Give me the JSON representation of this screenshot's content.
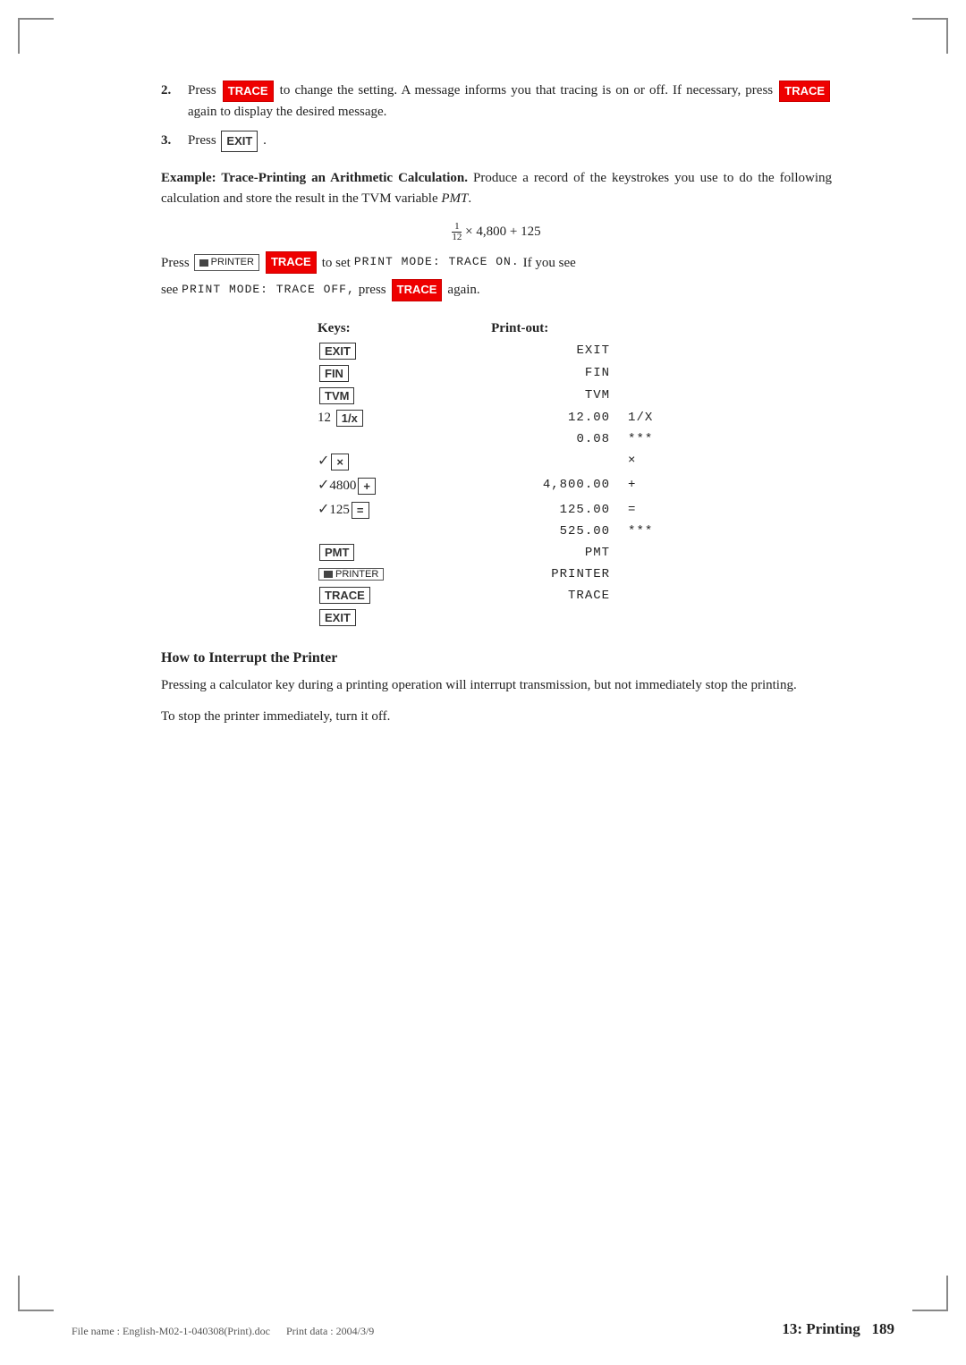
{
  "corner_marks": [
    "tl",
    "tr",
    "bl",
    "br"
  ],
  "step2": {
    "num": "2.",
    "text_before_key1": "Press",
    "key1": "TRACE",
    "text_after_key1": "to change the setting. A message informs you that tracing is on or off. If necessary, press",
    "key2": "TRACE",
    "text_after_key2": "again to display the desired message."
  },
  "step3": {
    "num": "3.",
    "text_before_key": "Press",
    "key": "EXIT",
    "text_after_key": "."
  },
  "example": {
    "label": "Example: Trace-Printing an Arithmetic Calculation.",
    "description": "Produce a record of the keystrokes you use to do the following calculation and store the result in the TVM variable",
    "variable": "PMT",
    "formula_numerator": "1",
    "formula_denominator": "12",
    "formula_rest": "× 4,800 + 125",
    "print_mode_intro": "Press",
    "print_mode_key1_icon": "printer",
    "print_mode_key2": "TRACE",
    "print_mode_text": "to set",
    "print_mode_code": "PRINT MODE: TRACE ON.",
    "print_mode_suffix": "If you see",
    "print_mode_code2": "PRINT MODE: TRACE OFF,",
    "print_mode_key3": "TRACE",
    "print_mode_end": "again."
  },
  "table": {
    "col1_header": "Keys:",
    "col2_header": "Print-out:",
    "rows": [
      {
        "key_type": "badge",
        "key_label": "EXIT",
        "key_badge_style": "plain",
        "printout": "EXIT",
        "symbol": ""
      },
      {
        "key_type": "badge",
        "key_label": "FIN",
        "key_badge_style": "plain",
        "printout": "FIN",
        "symbol": ""
      },
      {
        "key_type": "badge",
        "key_label": "TVM",
        "key_badge_style": "plain",
        "printout": "TVM",
        "symbol": ""
      },
      {
        "key_type": "combo",
        "key_label": "12",
        "key_label2": "1/x",
        "key_badge_style": "plain",
        "printout": "12.00",
        "symbol": "1/X"
      },
      {
        "key_type": "plain",
        "key_label": "",
        "key_badge_style": "",
        "printout": "0.08",
        "symbol": "***"
      },
      {
        "key_type": "check_badge",
        "key_label": "×",
        "key_badge_style": "plain",
        "printout": "",
        "symbol": "×"
      },
      {
        "key_type": "check_combo",
        "key_label": "4800",
        "key_label2": "+",
        "key_badge_style": "plain",
        "printout": "4,800.00",
        "symbol": "+"
      },
      {
        "key_type": "check_combo",
        "key_label": "125",
        "key_label2": "=",
        "key_badge_style": "plain",
        "printout": "125.00",
        "symbol": "="
      },
      {
        "key_type": "plain",
        "key_label": "",
        "key_badge_style": "",
        "printout": "525.00",
        "symbol": "***"
      },
      {
        "key_type": "badge",
        "key_label": "PMT",
        "key_badge_style": "plain",
        "printout": "PMT",
        "symbol": ""
      },
      {
        "key_type": "printer_badge",
        "key_label": "PRINTER",
        "key_badge_style": "printer",
        "printout": "PRINTER",
        "symbol": ""
      },
      {
        "key_type": "badge",
        "key_label": "TRACE",
        "key_badge_style": "plain",
        "printout": "TRACE",
        "symbol": ""
      },
      {
        "key_type": "badge",
        "key_label": "EXIT",
        "key_badge_style": "plain",
        "printout": "",
        "symbol": ""
      }
    ]
  },
  "section_how": {
    "heading": "How to Interrupt the Printer",
    "para1": "Pressing a calculator key during a printing operation will interrupt transmission, but not immediately stop the printing.",
    "para2": "To stop the printer immediately, turn it off."
  },
  "footer": {
    "chapter": "13: Printing",
    "page": "189",
    "filename": "File name : English-M02-1-040308(Print).doc",
    "printdata": "Print data : 2004/3/9"
  }
}
